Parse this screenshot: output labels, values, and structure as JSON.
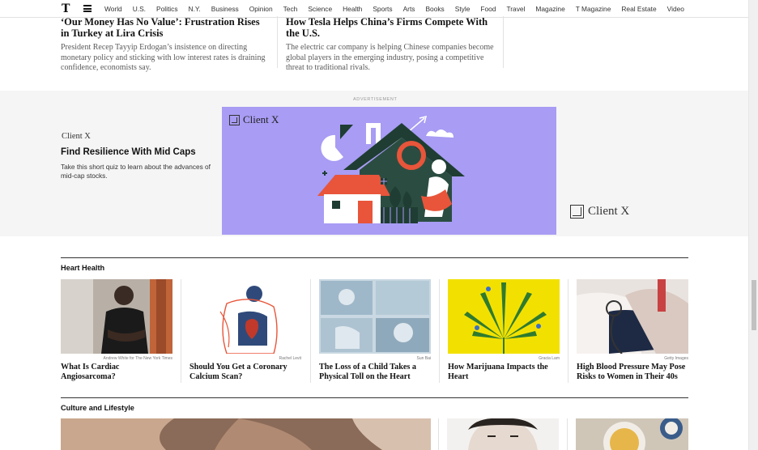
{
  "nav": {
    "logo": "T",
    "links": [
      "World",
      "U.S.",
      "Politics",
      "N.Y.",
      "Business",
      "Opinion",
      "Tech",
      "Science",
      "Health",
      "Sports",
      "Arts",
      "Books",
      "Style",
      "Food",
      "Travel",
      "Magazine",
      "T Magazine",
      "Real Estate",
      "Video"
    ]
  },
  "stories": [
    {
      "headline": "‘Our Money Has No Value’: Frustration Rises in Turkey at Lira Crisis",
      "summary": "President Recep Tayyip Erdogan’s insistence on directing monetary policy and sticking with low interest rates is draining confidence, economists say."
    },
    {
      "headline": "How Tesla Helps China’s Firms Compete With the U.S.",
      "summary": "The electric car company is helping Chinese companies become global players in the emerging industry, posing a competitive threat to traditional rivals."
    }
  ],
  "ad": {
    "label": "ADVERTISEMENT",
    "brand": "Client X",
    "title": "Find Resilience With Mid Caps",
    "body": "Take this short quiz to learn about the advances of mid-cap stocks.",
    "brand_in_image": "Client X",
    "brand_outside": "Client X"
  },
  "heart_health": {
    "title": "Heart Health",
    "cards": [
      {
        "credit": "Andrew White for The New York Times",
        "headline": "What Is Cardiac Angiosarcoma?"
      },
      {
        "credit": "Rachel Levit",
        "headline": "Should You Get a Coronary Calcium Scan?"
      },
      {
        "credit": "Sun Bai",
        "headline": "The Loss of a Child Takes a Physical Toll on the Heart"
      },
      {
        "credit": "Gracia Lam",
        "headline": "How Marijuana Impacts the Heart"
      },
      {
        "credit": "Getty Images",
        "headline": "High Blood Pressure May Pose Risks to Women in Their 40s"
      }
    ]
  },
  "culture": {
    "title": "Culture and Lifestyle"
  },
  "colors": {
    "ad_background": "#a89cf4",
    "ad_band": "#f5f5f5",
    "accent_orange": "#e8553a"
  }
}
